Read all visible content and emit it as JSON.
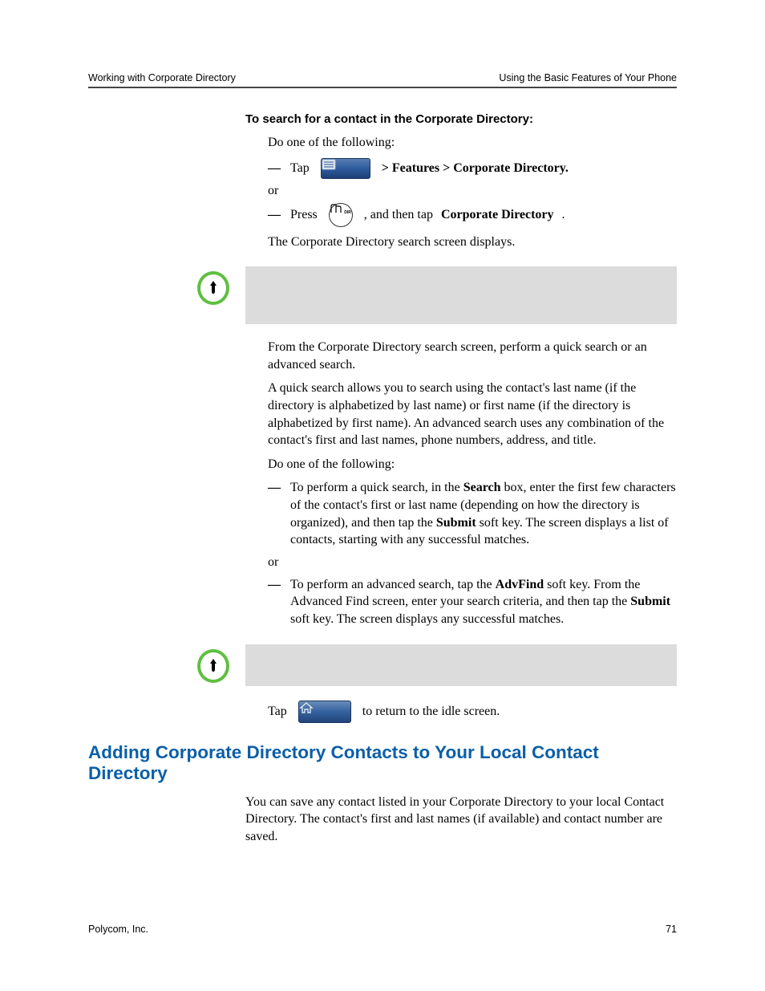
{
  "header": {
    "left": "Working with Corporate Directory",
    "right": "Using the Basic Features of Your Phone"
  },
  "step_heading": "To search for a contact in the Corporate Directory:",
  "do_one": "Do one of the following:",
  "dash": "—",
  "row1": {
    "tap": "Tap",
    "after": "   > Features > Corporate Directory."
  },
  "or": "or",
  "row2": {
    "press": "Press",
    "after1": " , and then tap ",
    "bold": "Corporate Directory",
    "period": "."
  },
  "search_displays": "The Corporate Directory search screen displays.",
  "para2": "From the Corporate Directory search screen, perform a quick search or an advanced search.",
  "para3": "A quick search allows you to search using the contact's last name (if the directory is alphabetized by last name) or first name (if the directory is alphabetized by first name). An advanced search uses any combination of the contact's first and last names, phone numbers, address, and title.",
  "do_one2": "Do one of the following:",
  "item1": {
    "pre": "To perform a quick search, in the ",
    "b1": "Search",
    "mid1": " box, enter the first few characters of the contact's first or last name (depending on how the directory is organized), and then tap the ",
    "b2": "Submit",
    "post": " soft key. The screen displays a list of contacts, starting with any successful matches."
  },
  "item2": {
    "pre": "To perform an advanced search, tap the ",
    "b1": "AdvFind",
    "mid1": " soft key. From the Advanced Find screen, enter your search criteria, and then tap the ",
    "b2": "Submit",
    "post": " soft key. The screen displays any successful matches."
  },
  "tap_return": {
    "pre": "Tap",
    "post": " to return to the idle screen."
  },
  "h2": "Adding Corporate Directory Contacts to Your Local Contact Directory",
  "para4": "You can save any contact listed in your Corporate Directory to your local Contact Directory. The contact's first and last names (if available) and contact number are saved.",
  "footer": {
    "left": "Polycom, Inc.",
    "right": "71"
  },
  "icons": {
    "menu": "menu-icon",
    "dir": "dir-hardkey-icon",
    "home": "home-icon",
    "tip": "tip-icon"
  }
}
